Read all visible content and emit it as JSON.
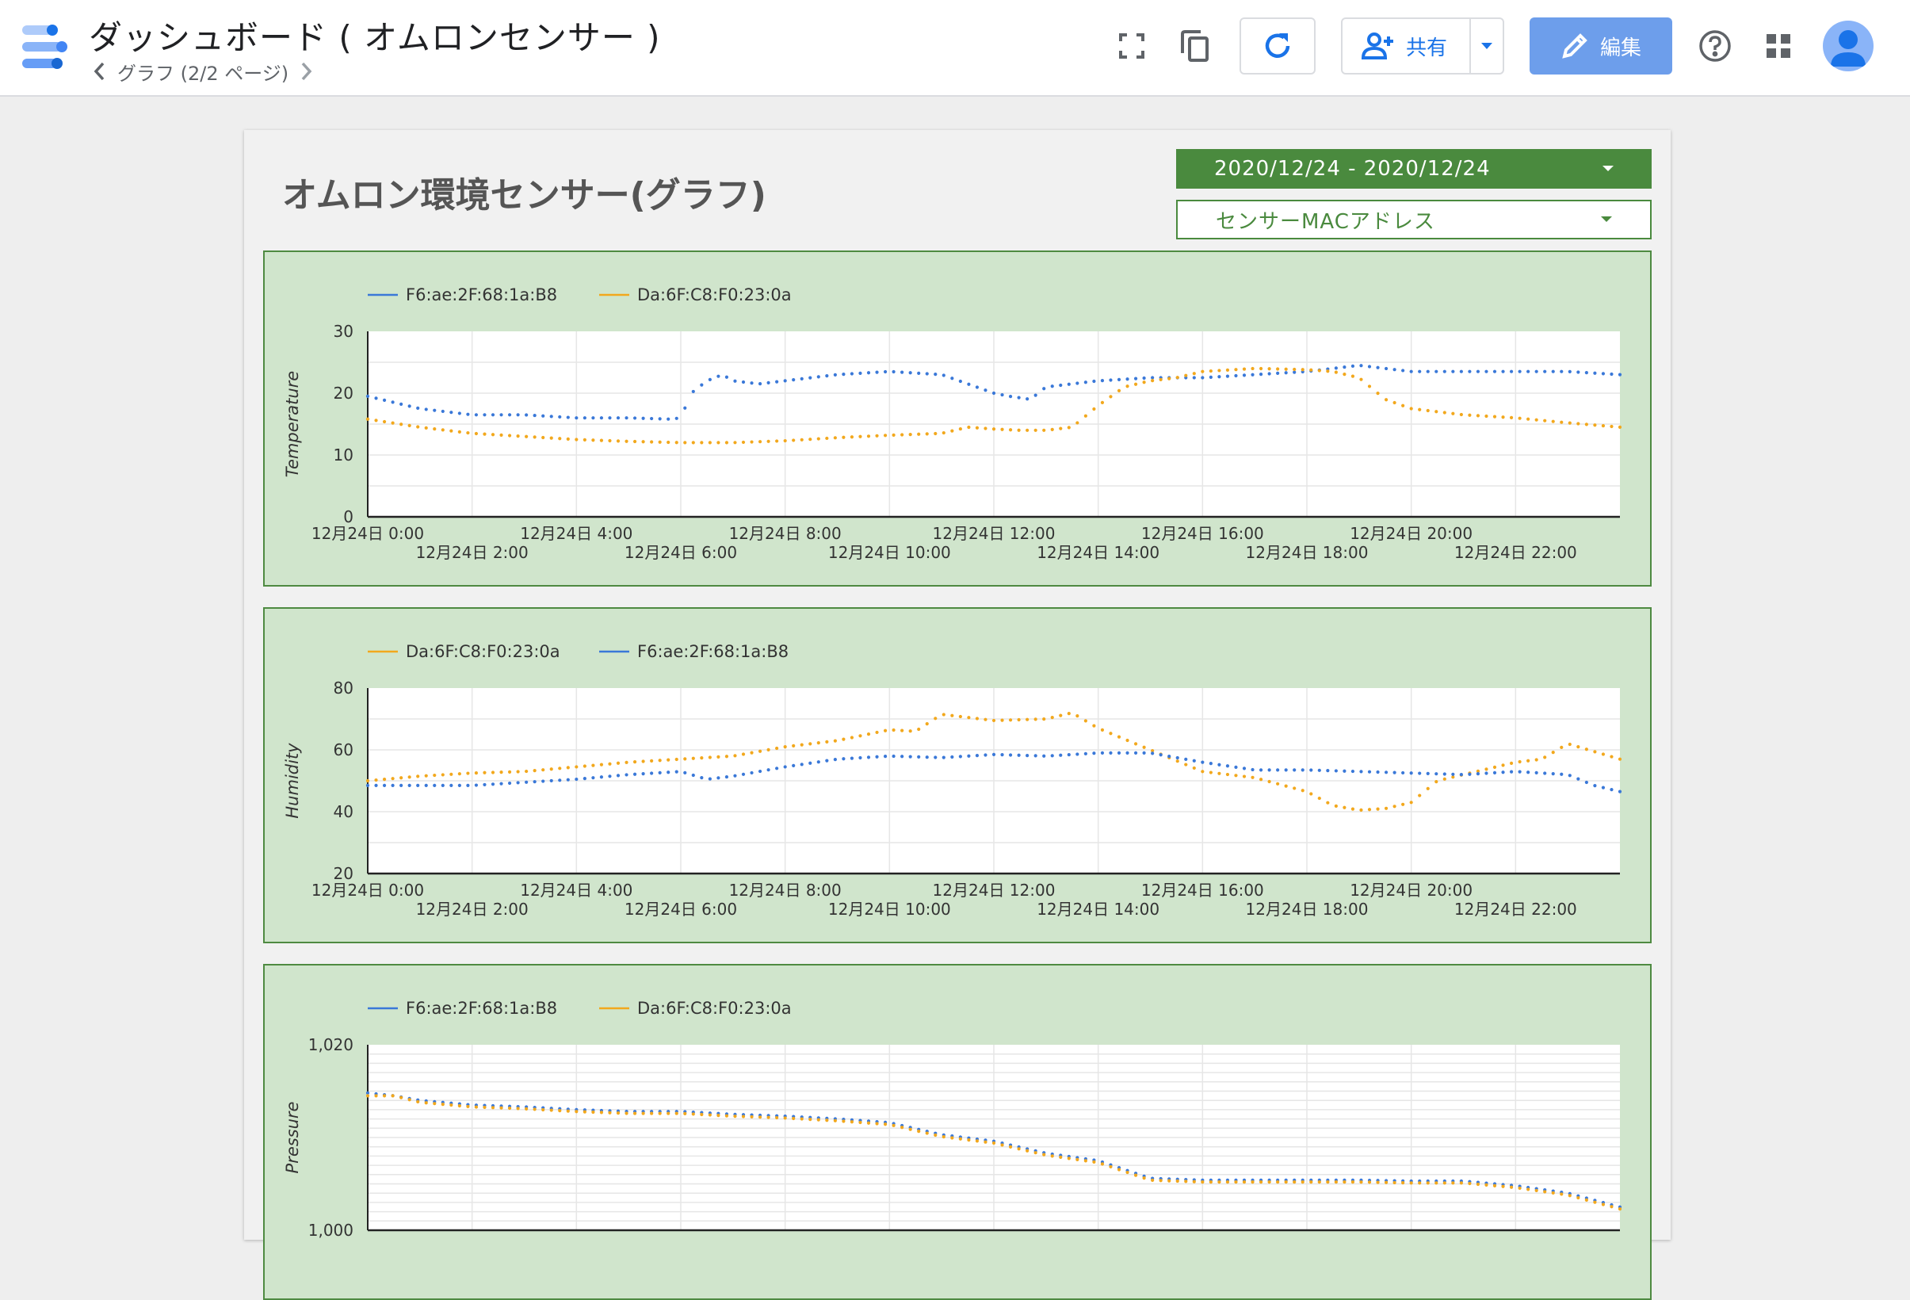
{
  "header": {
    "app_title": "ダッシュボード ( オムロンセンサー )",
    "page_label": "グラフ (2/2 ページ)",
    "share_label": "共有",
    "edit_label": "編集"
  },
  "icons": {
    "logo": "data-studio-logo-icon",
    "prev": "chevron-left-icon",
    "next": "chevron-right-icon",
    "fullscreen": "fullscreen-icon",
    "copy": "copy-icon",
    "refresh": "refresh-icon",
    "share": "person-add-icon",
    "share_caret": "caret-down-icon",
    "edit": "pencil-icon",
    "help": "help-icon",
    "apps": "apps-grid-icon",
    "avatar": "account-avatar-icon"
  },
  "colors": {
    "accent_blue": "#1a73e8",
    "edit_button": "#6d9eeb",
    "control_green": "#4a8a3e",
    "panel_bg": "#d0e5cc",
    "series_blue": "#3a78d8",
    "series_orange": "#f2a81d"
  },
  "report": {
    "title": "オムロン環境センサー(グラフ)",
    "date_range": "2020/12/24 - 2020/12/24",
    "mac_filter": "センサーMACアドレス"
  },
  "chart_data": [
    {
      "type": "scatter",
      "ylabel": "Temperature",
      "ylim": [
        0,
        30
      ],
      "yticks": [
        "0",
        "10",
        "20",
        "30"
      ],
      "y_gridlines": 6,
      "xlim": [
        0,
        24
      ],
      "xticks_top": [
        "12月24日 0:00",
        "12月24日 4:00",
        "12月24日 8:00",
        "12月24日 12:00",
        "12月24日 16:00",
        "12月24日 20:00"
      ],
      "xticks_bottom": [
        "12月24日 2:00",
        "12月24日 6:00",
        "12月24日 10:00",
        "12月24日 14:00",
        "12月24日 18:00",
        "12月24日 22:00"
      ],
      "legend": [
        "F6:ae:2F:68:1a:B8",
        "Da:6F:C8:F0:23:0a"
      ],
      "legend_position": "top-left",
      "series": [
        {
          "name": "F6:ae:2F:68:1a:B8",
          "color": "#3a78d8",
          "x": [
            0,
            0.5,
            1,
            1.5,
            2,
            3,
            4,
            5,
            5.8,
            6,
            6.2,
            6.5,
            6.8,
            7,
            7.5,
            8,
            9,
            10,
            11,
            11.5,
            12,
            12.3,
            12.7,
            13,
            13.5,
            14,
            15,
            16,
            17,
            18,
            18.5,
            19,
            20,
            21,
            22,
            23,
            24
          ],
          "y": [
            19.5,
            18.5,
            17.5,
            17,
            16.5,
            16.5,
            16,
            16,
            15.8,
            16,
            20,
            22,
            23,
            22,
            21.5,
            22,
            23,
            23.5,
            23,
            21.5,
            20,
            19.5,
            19,
            21,
            21.5,
            22,
            22.5,
            22.5,
            23,
            23.5,
            24,
            24.5,
            23.5,
            23.5,
            23.5,
            23.5,
            23
          ]
        },
        {
          "name": "Da:6F:C8:F0:23:0a",
          "color": "#f2a81d",
          "x": [
            0,
            1,
            2,
            3,
            4,
            5,
            6,
            7,
            8,
            9,
            10,
            11,
            11.5,
            12,
            12.5,
            13,
            13.5,
            14,
            14.5,
            15,
            15.5,
            16,
            17,
            18,
            18.5,
            19,
            19.5,
            20,
            21,
            22,
            23,
            24
          ],
          "y": [
            15.8,
            14.5,
            13.5,
            13,
            12.5,
            12.2,
            12,
            12,
            12.3,
            12.8,
            13.2,
            13.5,
            14.5,
            14.2,
            14,
            14,
            14.5,
            18,
            21,
            22,
            22.5,
            23.5,
            24,
            23.8,
            23.5,
            22.5,
            19,
            17.5,
            16.5,
            16,
            15.2,
            14.5
          ]
        }
      ]
    },
    {
      "type": "scatter",
      "ylabel": "Humidity",
      "ylim": [
        20,
        80
      ],
      "yticks": [
        "20",
        "40",
        "60",
        "80"
      ],
      "y_gridlines": 6,
      "xlim": [
        0,
        24
      ],
      "xticks_top": [
        "12月24日 0:00",
        "12月24日 4:00",
        "12月24日 8:00",
        "12月24日 12:00",
        "12月24日 16:00",
        "12月24日 20:00"
      ],
      "xticks_bottom": [
        "12月24日 2:00",
        "12月24日 6:00",
        "12月24日 10:00",
        "12月24日 14:00",
        "12月24日 18:00",
        "12月24日 22:00"
      ],
      "legend": [
        "Da:6F:C8:F0:23:0a",
        "F6:ae:2F:68:1a:B8"
      ],
      "legend_position": "top-left",
      "series": [
        {
          "name": "Da:6F:C8:F0:23:0a",
          "color": "#f2a81d",
          "x": [
            0,
            1,
            2,
            3,
            4,
            5,
            6,
            7,
            8,
            8.5,
            9,
            10,
            10.5,
            11,
            12,
            13,
            13.5,
            14,
            15,
            16,
            17,
            18,
            18.5,
            19,
            19.5,
            20,
            20.5,
            21,
            22,
            22.5,
            23,
            24
          ],
          "y": [
            50,
            51.5,
            52.5,
            53,
            54.5,
            56,
            57,
            58,
            61,
            62,
            63,
            66.5,
            66,
            71.5,
            69.5,
            70,
            72,
            67,
            60,
            53,
            51,
            46.5,
            42,
            40.5,
            41,
            43,
            50,
            52,
            56,
            57,
            62,
            57
          ]
        },
        {
          "name": "F6:ae:2F:68:1a:B8",
          "color": "#3a78d8",
          "x": [
            0,
            1,
            2,
            3,
            4,
            5,
            6,
            6.5,
            7,
            8,
            9,
            10,
            11,
            12,
            13,
            14,
            15,
            16,
            17,
            18,
            19,
            20,
            21,
            22,
            23,
            23.5,
            24
          ],
          "y": [
            48.5,
            48.5,
            48.5,
            49.5,
            50.5,
            52,
            53,
            50.5,
            51.5,
            54.5,
            57,
            58,
            57.5,
            58.5,
            58,
            59,
            59,
            56,
            53.5,
            53.5,
            53,
            52.5,
            52,
            53,
            52,
            48.5,
            46.5
          ]
        }
      ]
    },
    {
      "type": "scatter",
      "ylabel": "Pressure",
      "ylim": [
        1000,
        1020
      ],
      "yticks": [
        "1,000",
        "1,020"
      ],
      "y_gridlines": 20,
      "xlim": [
        0,
        24
      ],
      "xticks_top": [],
      "xticks_bottom": [],
      "legend": [
        "F6:ae:2F:68:1a:B8",
        "Da:6F:C8:F0:23:0a"
      ],
      "legend_position": "top-left",
      "series": [
        {
          "name": "F6:ae:2F:68:1a:B8",
          "color": "#3a78d8",
          "x": [
            0,
            0.5,
            1,
            2,
            3,
            4,
            5,
            6,
            7,
            8,
            9,
            10,
            11,
            12,
            13,
            14,
            15,
            16,
            17,
            18,
            19,
            20,
            21,
            22,
            23,
            24
          ],
          "y": [
            1014.8,
            1014.5,
            1014,
            1013.5,
            1013.3,
            1013,
            1012.8,
            1012.8,
            1012.5,
            1012.3,
            1012,
            1011.6,
            1010.3,
            1009.6,
            1008.3,
            1007.5,
            1005.6,
            1005.4,
            1005.4,
            1005.4,
            1005.4,
            1005.3,
            1005.3,
            1004.8,
            1004,
            1002.5
          ]
        },
        {
          "name": "Da:6F:C8:F0:23:0a",
          "color": "#f2a81d",
          "x": [
            0,
            0.5,
            1,
            2,
            3,
            4,
            5,
            6,
            7,
            8,
            9,
            10,
            11,
            12,
            13,
            14,
            15,
            16,
            17,
            18,
            19,
            20,
            21,
            22,
            23,
            24
          ],
          "y": [
            1014.5,
            1014.5,
            1013.8,
            1013.3,
            1013.1,
            1012.8,
            1012.6,
            1012.6,
            1012.3,
            1012.1,
            1011.8,
            1011.4,
            1010.1,
            1009.4,
            1008.1,
            1007.3,
            1005.4,
            1005.2,
            1005.2,
            1005.2,
            1005.2,
            1005.1,
            1005.1,
            1004.6,
            1003.8,
            1002.3
          ]
        }
      ]
    }
  ]
}
